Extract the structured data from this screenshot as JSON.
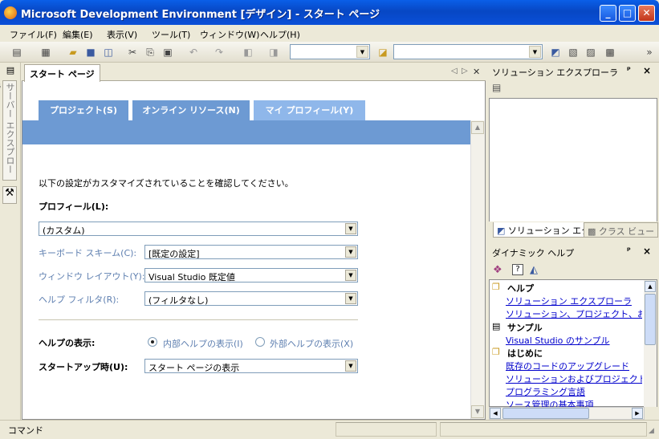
{
  "window": {
    "title": "Microsoft Development Environment [デザイン] - スタート ページ",
    "minimize": "_",
    "maximize": "□",
    "close": "✕"
  },
  "menu": [
    "ファイル(F)",
    "編集(E)",
    "表示(V)",
    "ツール(T)",
    "ウィンドウ(W)",
    "ヘルプ(H)"
  ],
  "left_strip": {
    "server_tab": "サーバー エクスプローラ"
  },
  "document": {
    "tab": "スタート ページ",
    "tabs": [
      "プロジェクト(S)",
      "オンライン リソース(N)",
      "マイ プロフィール(Y)"
    ],
    "intro": "以下の設定がカスタマイズされていることを確認してください。",
    "profile_label": "プロフィール(L):",
    "profile_value": "(カスタム)",
    "keyboard_label": "キーボード スキーム(C):",
    "keyboard_value": "[既定の設定]",
    "layout_label": "ウィンドウ レイアウト(Y):",
    "layout_value": "Visual Studio 既定値",
    "filter_label": "ヘルプ フィルタ(R):",
    "filter_value": "(フィルタなし)",
    "help_display_label": "ヘルプの表示:",
    "help_internal": "内部ヘルプの表示(I)",
    "help_external": "外部ヘルプの表示(X)",
    "help_selected": "internal",
    "startup_label": "スタートアップ時(U):",
    "startup_value": "スタート ページの表示"
  },
  "solution_explorer": {
    "title": "ソリューション エクスプローラ",
    "pin": "ᵖ",
    "close": "×",
    "tabs": [
      "ソリューション エク...",
      "クラス ビュー"
    ]
  },
  "dynamic_help": {
    "title": "ダイナミック ヘルプ",
    "sections": [
      {
        "heading": "ヘルプ",
        "links": [
          "ソリューション エクスプローラ",
          "ソリューション、プロジェクト、およびファ"
        ]
      },
      {
        "heading": "サンプル",
        "links": [
          "Visual Studio のサンプル"
        ]
      },
      {
        "heading": "はじめに",
        "links": [
          "既存のコードのアップグレード",
          "ソリューションおよびプロジェクトの新規",
          "プログラミング言語",
          "ソース管理の基本事項"
        ]
      }
    ]
  },
  "status": {
    "text": "コマンド"
  }
}
